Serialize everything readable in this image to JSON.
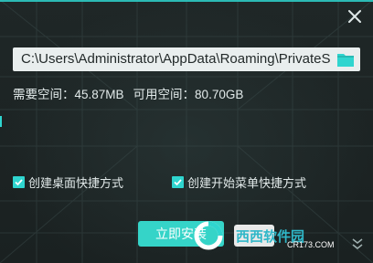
{
  "window": {
    "close_icon": "close-icon"
  },
  "install_path": {
    "value": "C:\\Users\\Administrator\\AppData\\Roaming\\PrivateS",
    "browse_icon": "folder-icon"
  },
  "space": {
    "required": "需要空间：45.87MB",
    "available": "可用空间：80.70GB"
  },
  "options": [
    {
      "label": "创建桌面快捷方式",
      "checked": true
    },
    {
      "label": "创建开始菜单快捷方式",
      "checked": true
    }
  ],
  "actions": {
    "install_label": "立即安装"
  },
  "watermark": {
    "brand": "西西软件园",
    "url": "CR173.COM"
  },
  "colors": {
    "accent": "#2fd5cf",
    "background": "#1c2323",
    "button": "#35d4c8"
  }
}
